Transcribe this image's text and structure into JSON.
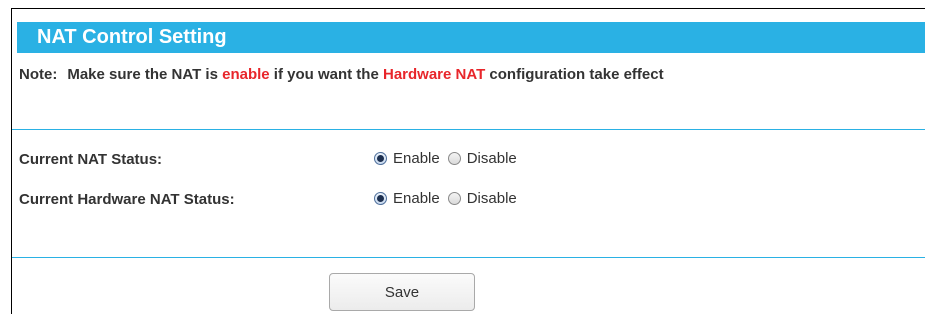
{
  "panel": {
    "title": "NAT Control Setting"
  },
  "note": {
    "label": "Note:",
    "text_1": "Make sure the NAT is ",
    "highlight_1": "enable",
    "text_2": " if you want the ",
    "highlight_2": "Hardware NAT",
    "text_3": " configuration take effect"
  },
  "settings": [
    {
      "label": "Current NAT Status:",
      "options": [
        "Enable",
        "Disable"
      ],
      "selected": "Enable"
    },
    {
      "label": "Current Hardware NAT Status:",
      "options": [
        "Enable",
        "Disable"
      ],
      "selected": "Enable"
    }
  ],
  "actions": {
    "save_label": "Save"
  },
  "colors": {
    "accent": "#2ab1e4",
    "highlight": "#e8262b"
  }
}
